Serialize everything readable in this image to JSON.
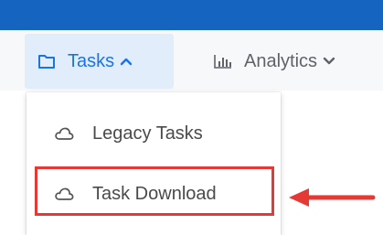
{
  "colors": {
    "topbar": "#1565c0",
    "navbar_bg": "#f7f8fa",
    "active_tab_bg": "#e1edfb",
    "active_tab_text": "#1a73e8",
    "inactive_text": "#5f6368",
    "menu_text": "#4a4a4a",
    "annotation_red": "#e53935"
  },
  "navbar": {
    "tasks": {
      "label": "Tasks",
      "icon": "folder-icon",
      "chevron": "chevron-up-icon",
      "active": true
    },
    "analytics": {
      "label": "Analytics",
      "icon": "bar-chart-icon",
      "chevron": "chevron-down-icon"
    }
  },
  "dropdown": {
    "items": [
      {
        "label": "Legacy Tasks",
        "icon": "cloud-icon"
      },
      {
        "label": "Task Download",
        "icon": "cloud-icon"
      }
    ]
  },
  "annotation": {
    "highlighted_item": "Task Download",
    "pointer": "arrow-left-icon"
  }
}
